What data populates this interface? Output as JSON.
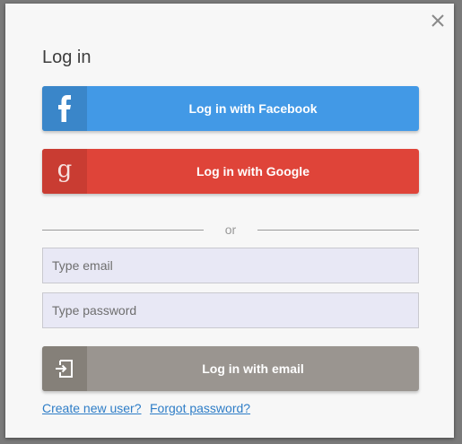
{
  "dialog": {
    "title": "Log in",
    "close_icon": "close-icon"
  },
  "buttons": {
    "facebook": {
      "label": "Log in with Facebook",
      "icon": "facebook-icon",
      "color": "#4299e6",
      "icon_bg": "#3a86c9"
    },
    "google": {
      "label": "Log in with Google",
      "icon": "google-icon",
      "color": "#df4439",
      "icon_bg": "#c93c32"
    },
    "email": {
      "label": "Log in with email",
      "icon": "login-icon",
      "color": "#9a9590",
      "icon_bg": "#858079"
    }
  },
  "divider": {
    "text": "or"
  },
  "form": {
    "email_placeholder": "Type email",
    "email_value": "",
    "password_placeholder": "Type password",
    "password_value": ""
  },
  "links": {
    "create": "Create new user?",
    "forgot": "Forgot password?"
  },
  "colors": {
    "link": "#2e7dc7",
    "input_bg": "#e8e8f5",
    "dialog_bg": "#f7f7f7"
  }
}
